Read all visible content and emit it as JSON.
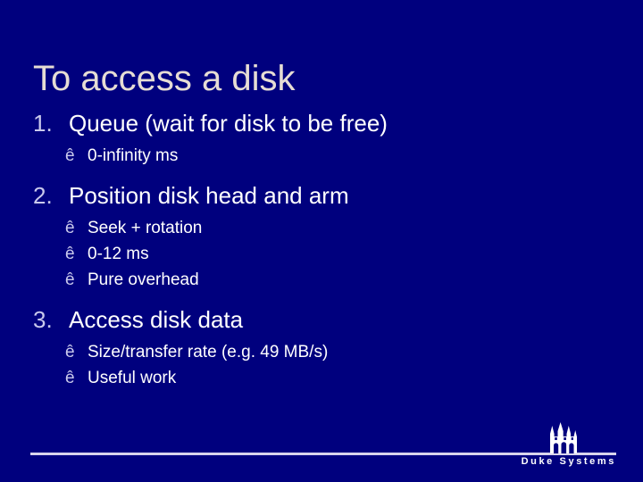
{
  "slide": {
    "title": "To access a disk",
    "background_color": "#00007e",
    "title_color": "#e6ddd4",
    "body_color": "#ffffff",
    "marker_color": "#c9c9ec",
    "rule_color": "#d8d4ec"
  },
  "body": {
    "items": [
      {
        "number": "1.",
        "text": "Queue (wait for disk to be free)",
        "bullets": [
          {
            "marker": "ê",
            "text": "0-infinity ms"
          }
        ]
      },
      {
        "number": "2.",
        "text": "Position disk head and arm",
        "bullets": [
          {
            "marker": "ê",
            "text": "Seek + rotation"
          },
          {
            "marker": "ê",
            "text": "0-12 ms"
          },
          {
            "marker": "ê",
            "text": "Pure overhead"
          }
        ]
      },
      {
        "number": "3.",
        "text": "Access disk data",
        "bullets": [
          {
            "marker": "ê",
            "text": "Size/transfer rate (e.g. 49 MB/s)"
          },
          {
            "marker": "ê",
            "text": "Useful work"
          }
        ]
      }
    ]
  },
  "footer": {
    "logo_label": "Duke Systems",
    "logo_icon": "duke-chapel-tower-icon"
  }
}
